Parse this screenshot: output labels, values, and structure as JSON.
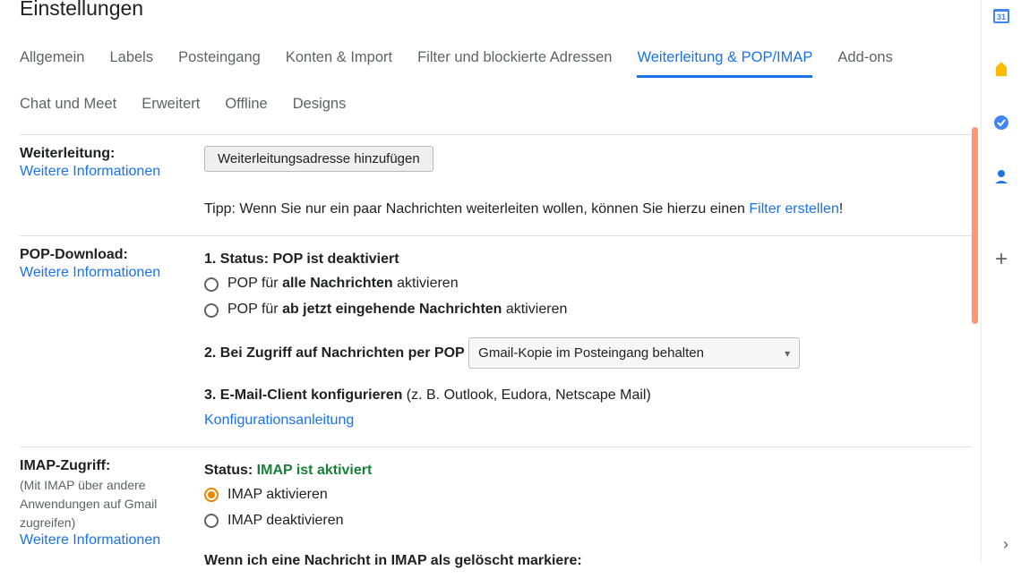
{
  "page_title": "Einstellungen",
  "tabs": {
    "t0": "Allgemein",
    "t1": "Labels",
    "t2": "Posteingang",
    "t3": "Konten & Import",
    "t4": "Filter und blockierte Adressen",
    "t5": "Weiterleitung & POP/IMAP",
    "t6": "Add-ons",
    "t7": "Chat und Meet",
    "t8": "Erweitert",
    "t9": "Offline",
    "t10": "Designs"
  },
  "forwarding": {
    "title": "Weiterleitung:",
    "more_info": "Weitere Informationen",
    "button": "Weiterleitungsadresse hinzufügen",
    "tip_prefix": "Tipp: Wenn Sie nur ein paar Nachrichten weiterleiten wollen, können Sie hierzu einen ",
    "tip_link": "Filter erstellen",
    "tip_suffix": "!"
  },
  "pop": {
    "title": "POP-Download:",
    "more_info": "Weitere Informationen",
    "status_prefix": "1. Status: ",
    "status_value": "POP ist deaktiviert",
    "opt1_a": "POP für ",
    "opt1_b": "alle Nachrichten",
    "opt1_c": " aktivieren",
    "opt2_a": "POP für ",
    "opt2_b": "ab jetzt eingehende Nachrichten",
    "opt2_c": " aktivieren",
    "step2": "2. Bei Zugriff auf Nachrichten per POP",
    "select_value": "Gmail-Kopie im Posteingang behalten",
    "step3_a": "3. E-Mail-Client konfigurieren",
    "step3_b": " (z. B. Outlook, Eudora, Netscape Mail)",
    "config_link": "Konfigurationsanleitung"
  },
  "imap": {
    "title": "IMAP-Zugriff:",
    "sub": "(Mit IMAP über andere Anwendungen auf Gmail zugreifen)",
    "more_info": "Weitere Informationen",
    "status_label": "Status: ",
    "status_value": "IMAP ist aktiviert",
    "opt1": "IMAP aktivieren",
    "opt2": "IMAP deaktivieren",
    "delete_heading": "Wenn ich eine Nachricht in IMAP als gelöscht markiere:"
  }
}
